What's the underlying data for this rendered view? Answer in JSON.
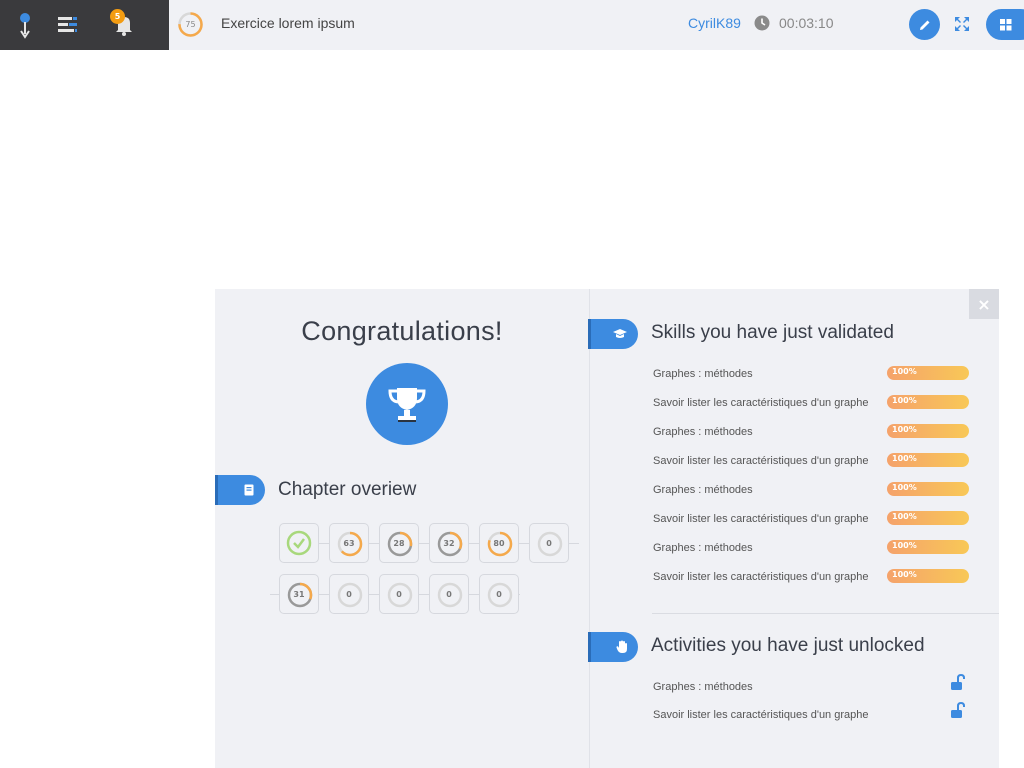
{
  "header": {
    "notifications_count": "5",
    "progress_value": "75",
    "exercise_title": "Exercice lorem ipsum",
    "username": "CyrilK89",
    "timer": "00:03:10",
    "icons": [
      "pin-icon",
      "menu-icon",
      "bell-icon",
      "clock-icon",
      "pencil-icon",
      "expand-icon",
      "grid-icon"
    ],
    "accent_color": "#3d8be0",
    "badge_color": "#f39c12"
  },
  "panel": {
    "close_label": "×",
    "congrats_title": "Congratulations!",
    "chapter": {
      "title": "Chapter overiew",
      "rows": [
        [
          {
            "value": "",
            "done": true
          },
          {
            "value": "63"
          },
          {
            "value": "28"
          },
          {
            "value": "32"
          },
          {
            "value": "80"
          },
          {
            "value": "0"
          }
        ],
        [
          {
            "value": "31"
          },
          {
            "value": "0"
          },
          {
            "value": "0"
          },
          {
            "value": "0"
          },
          {
            "value": "0"
          }
        ]
      ]
    },
    "skills": {
      "title": "Skills you have just validated",
      "items": [
        {
          "label": "Graphes : méthodes",
          "percent": "100%"
        },
        {
          "label": "Savoir lister les caractéristiques d'un graphe",
          "percent": "100%"
        },
        {
          "label": "Graphes : méthodes",
          "percent": "100%"
        },
        {
          "label": "Savoir lister les caractéristiques d'un graphe",
          "percent": "100%"
        },
        {
          "label": "Graphes : méthodes",
          "percent": "100%"
        },
        {
          "label": "Savoir lister les caractéristiques d'un graphe",
          "percent": "100%"
        },
        {
          "label": "Graphes : méthodes",
          "percent": "100%"
        },
        {
          "label": "Savoir lister les caractéristiques d'un graphe",
          "percent": "100%"
        }
      ]
    },
    "activities": {
      "title": "Activities you have just unlocked",
      "items": [
        {
          "label": "Graphes : méthodes"
        },
        {
          "label": "Savoir lister les caractéristiques d'un graphe"
        }
      ]
    }
  }
}
